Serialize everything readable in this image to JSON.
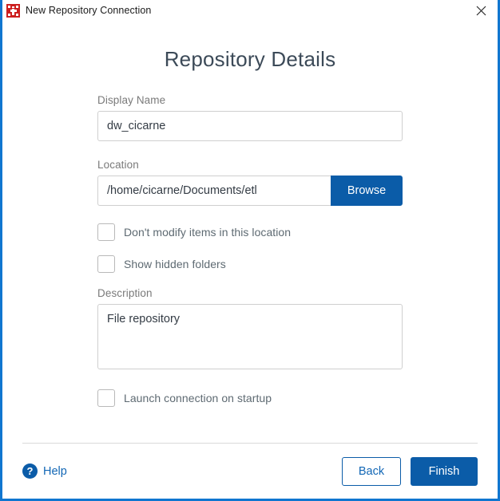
{
  "window": {
    "title": "New Repository Connection",
    "app_icon": "repository-logo-icon",
    "close_icon": "close-icon",
    "border_color": "#1076d0"
  },
  "page": {
    "title": "Repository Details"
  },
  "form": {
    "display_name": {
      "label": "Display Name",
      "value": "dw_cicarne",
      "placeholder": ""
    },
    "location": {
      "label": "Location",
      "value": "/home/cicarne/Documents/etl",
      "placeholder": "",
      "browse_label": "Browse"
    },
    "dont_modify": {
      "label": "Don't modify items in this location",
      "checked": false
    },
    "show_hidden": {
      "label": "Show hidden folders",
      "checked": false
    },
    "description": {
      "label": "Description",
      "value": "File repository",
      "placeholder": ""
    },
    "launch_on_startup": {
      "label": "Launch connection on startup",
      "checked": false
    }
  },
  "footer": {
    "help_label": "Help",
    "help_icon": "question-mark-icon",
    "back_label": "Back",
    "finish_label": "Finish"
  },
  "colors": {
    "accent_blue": "#0b5ca8",
    "link_blue": "#1166b5",
    "logo_red": "#cc1f1f",
    "label_gray": "#7a7a7a",
    "title_slate": "#3c4a58"
  }
}
